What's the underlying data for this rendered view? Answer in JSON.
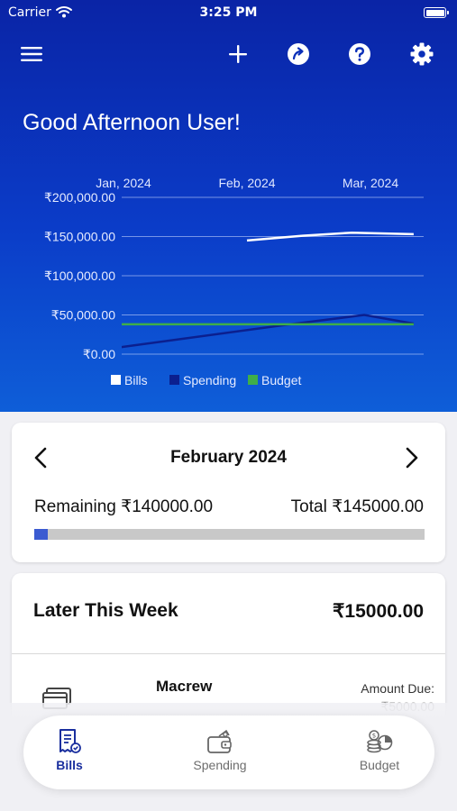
{
  "status_bar": {
    "carrier": "Carrier",
    "time": "3:25 PM"
  },
  "toolbar": {
    "menu_icon": "hamburger-menu-icon",
    "add_icon": "plus-icon",
    "share_icon": "share-arrow-icon",
    "help_icon": "question-circle-icon",
    "settings_icon": "gear-icon"
  },
  "greeting": "Good Afternoon User!",
  "colors": {
    "hero_top": "#0a24a6",
    "hero_bottom": "#0e5ed8",
    "bills_line": "#ffffff",
    "spending_line": "#0b1f8f",
    "budget_line": "#3fae49",
    "accent": "#1a2f9e",
    "progress_fill": "#3b5bd1"
  },
  "chart_data": {
    "type": "line",
    "x": [
      "Jan, 2024",
      "Feb, 2024",
      "Mar, 2024"
    ],
    "y_ticks": [
      "₹200,000.00",
      "₹150,000.00",
      "₹100,000.00",
      "₹50,000.00",
      "₹0.00"
    ],
    "ylim": [
      0,
      200000
    ],
    "grid": true,
    "legend_position": "bottom",
    "series": [
      {
        "name": "Bills",
        "color": "#ffffff",
        "values": [
          null,
          145000,
          151000
        ],
        "points": [
          [
            1.0,
            145000
          ],
          [
            1.45,
            151000
          ],
          [
            1.85,
            155000
          ],
          [
            2.35,
            153000
          ]
        ]
      },
      {
        "name": "Spending",
        "color": "#0b1f8f",
        "points": [
          [
            -0.35,
            2000
          ],
          [
            1.3,
            37000
          ],
          [
            1.95,
            50000
          ],
          [
            2.35,
            39000
          ]
        ]
      },
      {
        "name": "Budget",
        "color": "#3fae49",
        "points": [
          [
            -0.35,
            38000
          ],
          [
            2.35,
            38000
          ]
        ]
      }
    ]
  },
  "budget_card": {
    "month": "February 2024",
    "remaining": "Remaining ₹140000.00",
    "total": "Total ₹145000.00",
    "spent_fraction": 0.034
  },
  "later_this_week": {
    "label": "Later This Week",
    "amount": "₹15000.00",
    "bill": {
      "name": "Macrew",
      "due_label": "Amount Due:",
      "due_value": "₹5000.00"
    }
  },
  "tabs": [
    {
      "label": "Bills",
      "icon": "bills-receipt-icon",
      "active": true
    },
    {
      "label": "Spending",
      "icon": "wallet-icon",
      "active": false
    },
    {
      "label": "Budget",
      "icon": "budget-coins-pie-icon",
      "active": false
    }
  ]
}
